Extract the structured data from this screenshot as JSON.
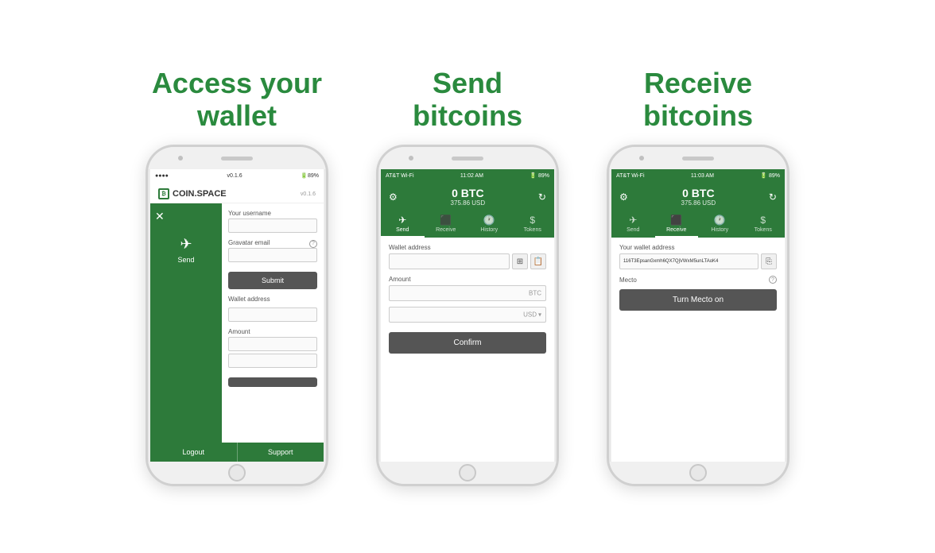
{
  "sections": [
    {
      "id": "wallet",
      "title_line1": "Access your",
      "title_line2": "wallet"
    },
    {
      "id": "send",
      "title_line1": "Send",
      "title_line2": "bitcoins"
    },
    {
      "id": "receive",
      "title_line1": "Receive",
      "title_line2": "bitcoins"
    }
  ],
  "phone1": {
    "status_bar": "v0.1.6",
    "logo": "COIN.SPACE",
    "version": "v0.1.6",
    "sidebar": {
      "send_label": "Send"
    },
    "form": {
      "username_label": "Your username",
      "gravatar_label": "Gravatar email",
      "submit_label": "Submit",
      "wallet_address_label": "Wallet address",
      "amount_label": "Amount"
    },
    "footer": {
      "logout": "Logout",
      "support": "Support"
    }
  },
  "phone2": {
    "status_left": "AT&T Wi-Fi",
    "status_time": "11:02 AM",
    "status_right": "89%",
    "balance_btc": "0 BTC",
    "balance_usd": "375.86 USD",
    "nav_tabs": [
      "Send",
      "Receive",
      "History",
      "Tokens"
    ],
    "form": {
      "wallet_address_label": "Wallet address",
      "amount_label": "Amount",
      "btc_suffix": "BTC",
      "usd_suffix": "USD",
      "confirm_label": "Confirm"
    }
  },
  "phone3": {
    "status_left": "AT&T Wi-Fi",
    "status_time": "11:03 AM",
    "status_right": "89%",
    "balance_btc": "0 BTC",
    "balance_usd": "375.86 USD",
    "nav_tabs": [
      "Send",
      "Receive",
      "History",
      "Tokens"
    ],
    "form": {
      "wallet_address_label": "Your wallet address",
      "wallet_address_value": "116T3EpsanGxmh6QX7QjVWxM5unLTAoK4",
      "mecto_label": "Mecto",
      "turn_mecto_label": "Turn Mecto on"
    }
  }
}
